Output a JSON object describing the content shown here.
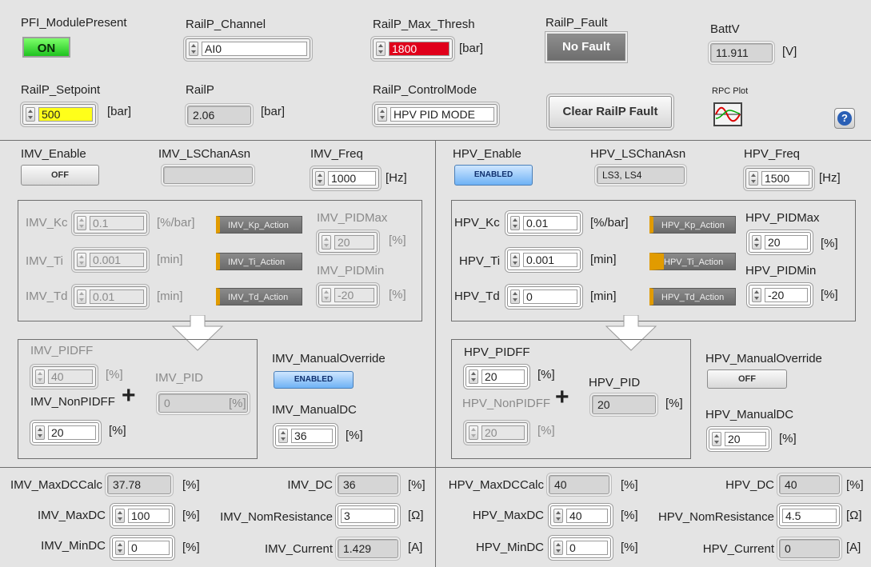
{
  "top": {
    "module_present": {
      "label": "PFI_ModulePresent",
      "state": "ON"
    },
    "rail_channel": {
      "label": "RailP_Channel",
      "value": "AI0"
    },
    "rail_max_thresh": {
      "label": "RailP_Max_Thresh",
      "value": "1800",
      "unit": "[bar]"
    },
    "rail_fault": {
      "label": "RailP_Fault",
      "value": "No Fault"
    },
    "batt_v": {
      "label": "BattV",
      "value": "11.911",
      "unit": "[V]"
    },
    "rail_setpoint": {
      "label": "RailP_Setpoint",
      "value": "500",
      "unit": "[bar]"
    },
    "rail_p": {
      "label": "RailP",
      "value": "2.06",
      "unit": "[bar]"
    },
    "rail_control_mode": {
      "label": "RailP_ControlMode",
      "value": "HPV PID MODE"
    },
    "clear_fault": {
      "label": "Clear RailP Fault"
    },
    "rpc_plot": {
      "label": "RPC Plot"
    },
    "help": {
      "label": "?"
    }
  },
  "imv": {
    "enable": {
      "label": "IMV_Enable",
      "state": "OFF"
    },
    "ls_chan": {
      "label": "IMV_LSChanAsn",
      "value": ""
    },
    "freq": {
      "label": "IMV_Freq",
      "value": "1000",
      "unit": "[Hz]"
    },
    "kc": {
      "label": "IMV_Kc",
      "value": "0.1",
      "unit": "[%/bar]"
    },
    "ti": {
      "label": "IMV_Ti",
      "value": "0.001",
      "unit": "[min]"
    },
    "td": {
      "label": "IMV_Td",
      "value": "0.01",
      "unit": "[min]"
    },
    "kp_action": "IMV_Kp_Action",
    "ti_action": "IMV_Ti_Action",
    "td_action": "IMV_Td_Action",
    "pid_max": {
      "label": "IMV_PIDMax",
      "value": "20",
      "unit": "[%]"
    },
    "pid_min": {
      "label": "IMV_PIDMin",
      "value": "-20",
      "unit": "[%]"
    },
    "pidff": {
      "label": "IMV_PIDFF",
      "value": "40",
      "unit": "[%]"
    },
    "pid": {
      "label": "IMV_PID",
      "value": "0",
      "unit": "[%]"
    },
    "non_pidff": {
      "label": "IMV_NonPIDFF",
      "value": "20",
      "unit": "[%]"
    },
    "plus": "+",
    "manual_override": {
      "label": "IMV_ManualOverride",
      "state": "ENABLED"
    },
    "manual_dc": {
      "label": "IMV_ManualDC",
      "value": "36",
      "unit": "[%]"
    },
    "max_dc_calc": {
      "label": "IMV_MaxDCCalc",
      "value": "37.78",
      "unit": "[%]"
    },
    "dc": {
      "label": "IMV_DC",
      "value": "36",
      "unit": "[%]"
    },
    "max_dc": {
      "label": "IMV_MaxDC",
      "value": "100",
      "unit": "[%]"
    },
    "nom_resistance": {
      "label": "IMV_NomResistance",
      "value": "3",
      "unit": "[Ω]"
    },
    "min_dc": {
      "label": "IMV_MinDC",
      "value": "0",
      "unit": "[%]"
    },
    "current": {
      "label": "IMV_Current",
      "value": "1.429",
      "unit": "[A]"
    }
  },
  "hpv": {
    "enable": {
      "label": "HPV_Enable",
      "state": "ENABLED"
    },
    "ls_chan": {
      "label": "HPV_LSChanAsn",
      "value": "LS3, LS4"
    },
    "freq": {
      "label": "HPV_Freq",
      "value": "1500",
      "unit": "[Hz]"
    },
    "kc": {
      "label": "HPV_Kc",
      "value": "0.01",
      "unit": "[%/bar]"
    },
    "ti": {
      "label": "HPV_Ti",
      "value": "0.001",
      "unit": "[min]"
    },
    "td": {
      "label": "HPV_Td",
      "value": "0",
      "unit": "[min]"
    },
    "kp_action": "HPV_Kp_Action",
    "ti_action": "HPV_Ti_Action",
    "td_action": "HPV_Td_Action",
    "pid_max": {
      "label": "HPV_PIDMax",
      "value": "20",
      "unit": "[%]"
    },
    "pid_min": {
      "label": "HPV_PIDMin",
      "value": "-20",
      "unit": "[%]"
    },
    "pidff": {
      "label": "HPV_PIDFF",
      "value": "20",
      "unit": "[%]"
    },
    "pid": {
      "label": "HPV_PID",
      "value": "20",
      "unit": "[%]"
    },
    "non_pidff": {
      "label": "HPV_NonPIDFF",
      "value": "20",
      "unit": "[%]"
    },
    "plus": "+",
    "manual_override": {
      "label": "HPV_ManualOverride",
      "state": "OFF"
    },
    "manual_dc": {
      "label": "HPV_ManualDC",
      "value": "20",
      "unit": "[%]"
    },
    "max_dc_calc": {
      "label": "HPV_MaxDCCalc",
      "value": "40",
      "unit": "[%]"
    },
    "dc": {
      "label": "HPV_DC",
      "value": "40",
      "unit": "[%]"
    },
    "max_dc": {
      "label": "HPV_MaxDC",
      "value": "40",
      "unit": "[%]"
    },
    "nom_resistance": {
      "label": "HPV_NomResistance",
      "value": "4.5",
      "unit": "[Ω]"
    },
    "min_dc": {
      "label": "HPV_MinDC",
      "value": "0",
      "unit": "[%]"
    },
    "current": {
      "label": "HPV_Current",
      "value": "0",
      "unit": "[A]"
    }
  },
  "colors": {
    "led_on": "#1fc21f",
    "alarm_red": "#e0001b",
    "setpoint_yellow": "#ffff1a",
    "enabled_blue": "#6fb2f5",
    "action_orange": "#e19b00"
  }
}
